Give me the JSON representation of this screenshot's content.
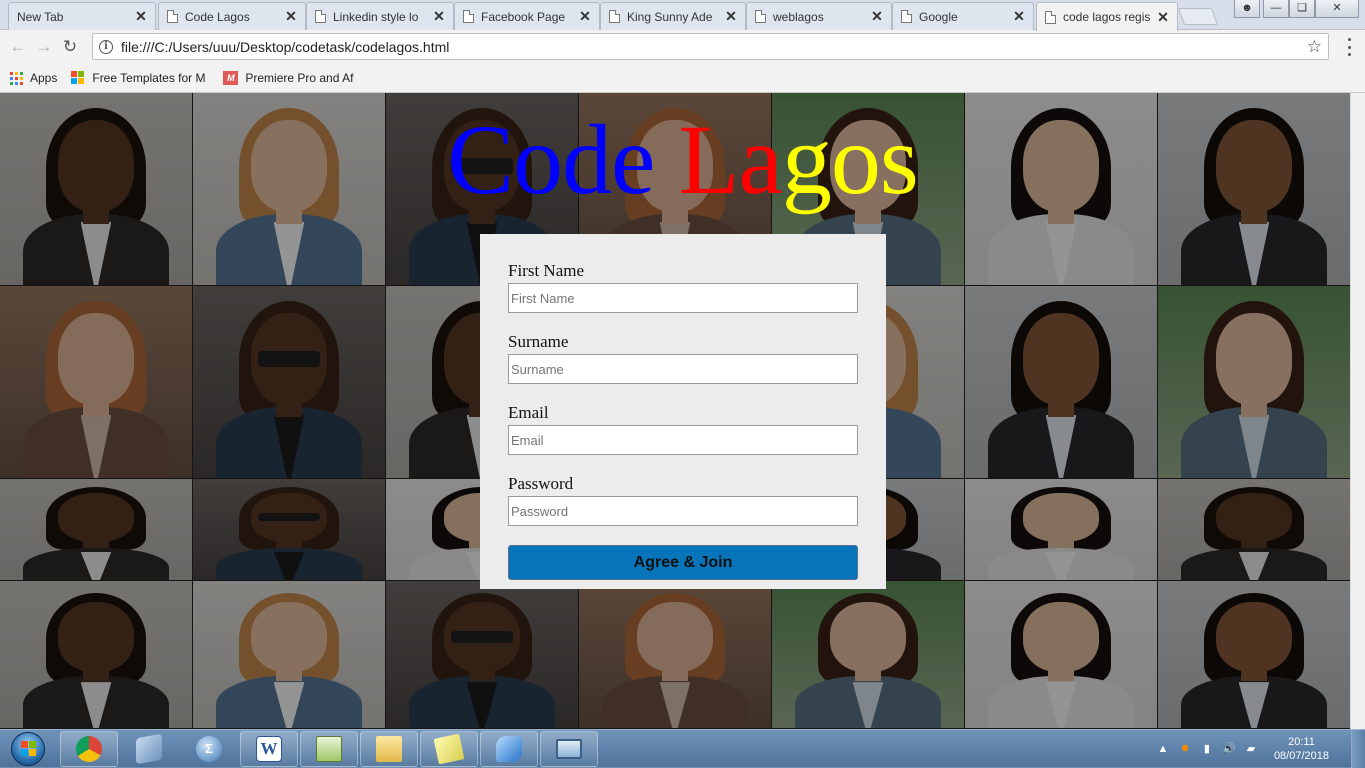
{
  "tabs": [
    {
      "title": "New Tab"
    },
    {
      "title": "Code Lagos"
    },
    {
      "title": "Linkedin style lo"
    },
    {
      "title": "Facebook Page"
    },
    {
      "title": "King Sunny Ade"
    },
    {
      "title": "weblagos"
    },
    {
      "title": "Google"
    },
    {
      "title": "code lagos regis"
    }
  ],
  "toolbar": {
    "url": "file:///C:/Users/uuu/Desktop/codetask/codelagos.html"
  },
  "bookmarks": [
    {
      "label": "Apps"
    },
    {
      "label": "Free Templates for M"
    },
    {
      "label": "Premiere Pro and Af"
    }
  ],
  "page": {
    "logo": [
      {
        "text": "Co",
        "color": "#0000ff"
      },
      {
        "text": "de ",
        "color": "#0000ff"
      },
      {
        "text": "L",
        "color": "#ff0000"
      },
      {
        "text": "a",
        "color": "#ff0000"
      },
      {
        "text": "gos",
        "color": "#ffff00"
      }
    ],
    "form": {
      "first_name_label": "First Name",
      "first_name_placeholder": "First Name",
      "surname_label": "Surname",
      "surname_placeholder": "Surname",
      "email_label": "Email",
      "email_placeholder": "Email",
      "password_label": "Password",
      "password_placeholder": "Password",
      "submit_label": "Agree & Join"
    }
  },
  "taskbar": {
    "time": "20:11",
    "date": "08/07/2018"
  },
  "colors": {
    "button_blue": "#0874b9",
    "logo_blue": "#0000ff",
    "logo_red": "#ff0000",
    "logo_yellow": "#ffff00"
  }
}
